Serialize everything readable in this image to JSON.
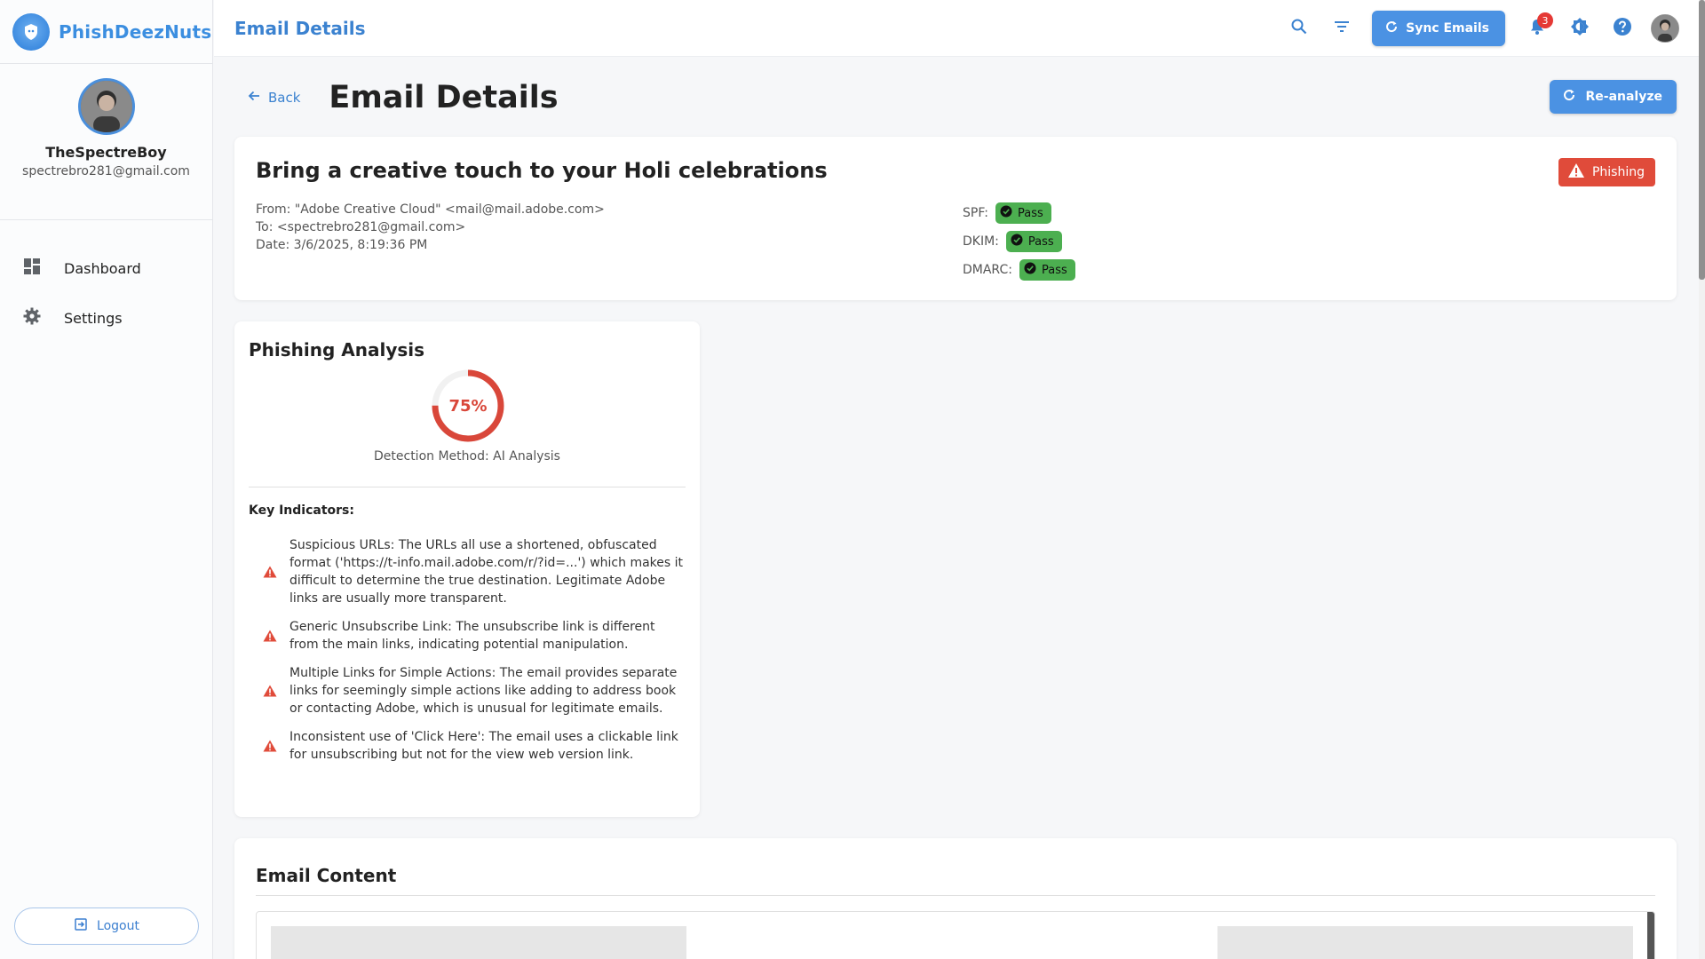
{
  "brand": {
    "name": "PhishDeezNuts"
  },
  "user": {
    "name": "TheSpectreBoy",
    "email": "spectrebro281@gmail.com"
  },
  "sidebar": {
    "items": [
      {
        "label": "Dashboard",
        "icon": "dashboard-icon"
      },
      {
        "label": "Settings",
        "icon": "gear-icon"
      }
    ],
    "logout_label": "Logout"
  },
  "topbar": {
    "title": "Email Details",
    "sync_label": "Sync Emails",
    "notification_count": "3"
  },
  "page": {
    "back_label": "Back",
    "title": "Email Details",
    "reanalyze_label": "Re-analyze"
  },
  "email": {
    "subject": "Bring a creative touch to your Holi celebrations",
    "verdict": "Phishing",
    "from": "From: \"Adobe Creative Cloud\" <mail@mail.adobe.com>",
    "to": "To: <spectrebro281@gmail.com>",
    "date": "Date: 3/6/2025, 8:19:36 PM",
    "auth": [
      {
        "label": "SPF:",
        "status": "Pass"
      },
      {
        "label": "DKIM:",
        "status": "Pass"
      },
      {
        "label": "DMARC:",
        "status": "Pass"
      }
    ]
  },
  "analysis": {
    "title": "Phishing Analysis",
    "score_text": "75%",
    "score": 0.75,
    "method": "Detection Method: AI Analysis",
    "key_indicators_title": "Key Indicators:",
    "indicators": [
      "Suspicious URLs: The URLs all use a shortened, obfuscated format ('https://t-info.mail.adobe.com/r/?id=...') which makes it difficult to determine the true destination. Legitimate Adobe links are usually more transparent.",
      "Generic Unsubscribe Link: The unsubscribe link is different from the main links, indicating potential manipulation.",
      "Multiple Links for Simple Actions: The email provides separate links for seemingly simple actions like adding to address book or contacting Adobe, which is unusual for legitimate emails.",
      "Inconsistent use of 'Click Here': The email uses a clickable link for unsubscribing but not for the view web version link."
    ]
  },
  "content": {
    "title": "Email Content"
  },
  "colors": {
    "accent": "#4b92e3",
    "danger": "#e04b3a",
    "success": "#4caf50"
  }
}
